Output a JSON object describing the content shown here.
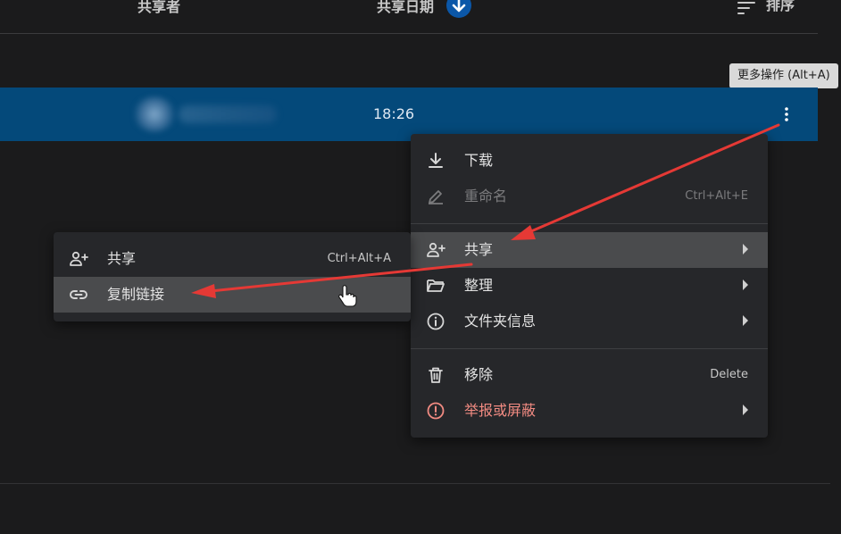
{
  "header": {
    "col_sharer": "共享者",
    "col_share_date": "共享日期",
    "sort_label": "排序"
  },
  "row": {
    "time": "18:26"
  },
  "tooltip": {
    "more_actions": "更多操作 (Alt+A)"
  },
  "context_menu": {
    "items": [
      {
        "label": "下载",
        "icon": "download-icon"
      },
      {
        "label": "重命名",
        "shortcut": "Ctrl+Alt+E",
        "icon": "rename-icon",
        "disabled": true
      },
      {
        "label": "共享",
        "icon": "person-add-icon",
        "submenu": true,
        "highlighted": true
      },
      {
        "label": "整理",
        "icon": "folder-open-icon",
        "submenu": true
      },
      {
        "label": "文件夹信息",
        "icon": "info-icon",
        "submenu": true
      },
      {
        "label": "移除",
        "shortcut": "Delete",
        "icon": "trash-icon"
      },
      {
        "label": "举报或屏蔽",
        "icon": "report-icon",
        "submenu": true,
        "danger": true
      }
    ]
  },
  "share_submenu": {
    "items": [
      {
        "label": "共享",
        "shortcut": "Ctrl+Alt+A",
        "icon": "person-add-icon"
      },
      {
        "label": "复制链接",
        "icon": "link-icon",
        "highlighted": true
      }
    ]
  },
  "colors": {
    "background": "#1b1b1c",
    "selected_row": "#04497a",
    "menu_bg": "#26272a",
    "highlight": "#4a4b4d",
    "danger": "#f28b82",
    "annotation_arrow": "#e53935",
    "sort_badge": "#0b57a8"
  }
}
